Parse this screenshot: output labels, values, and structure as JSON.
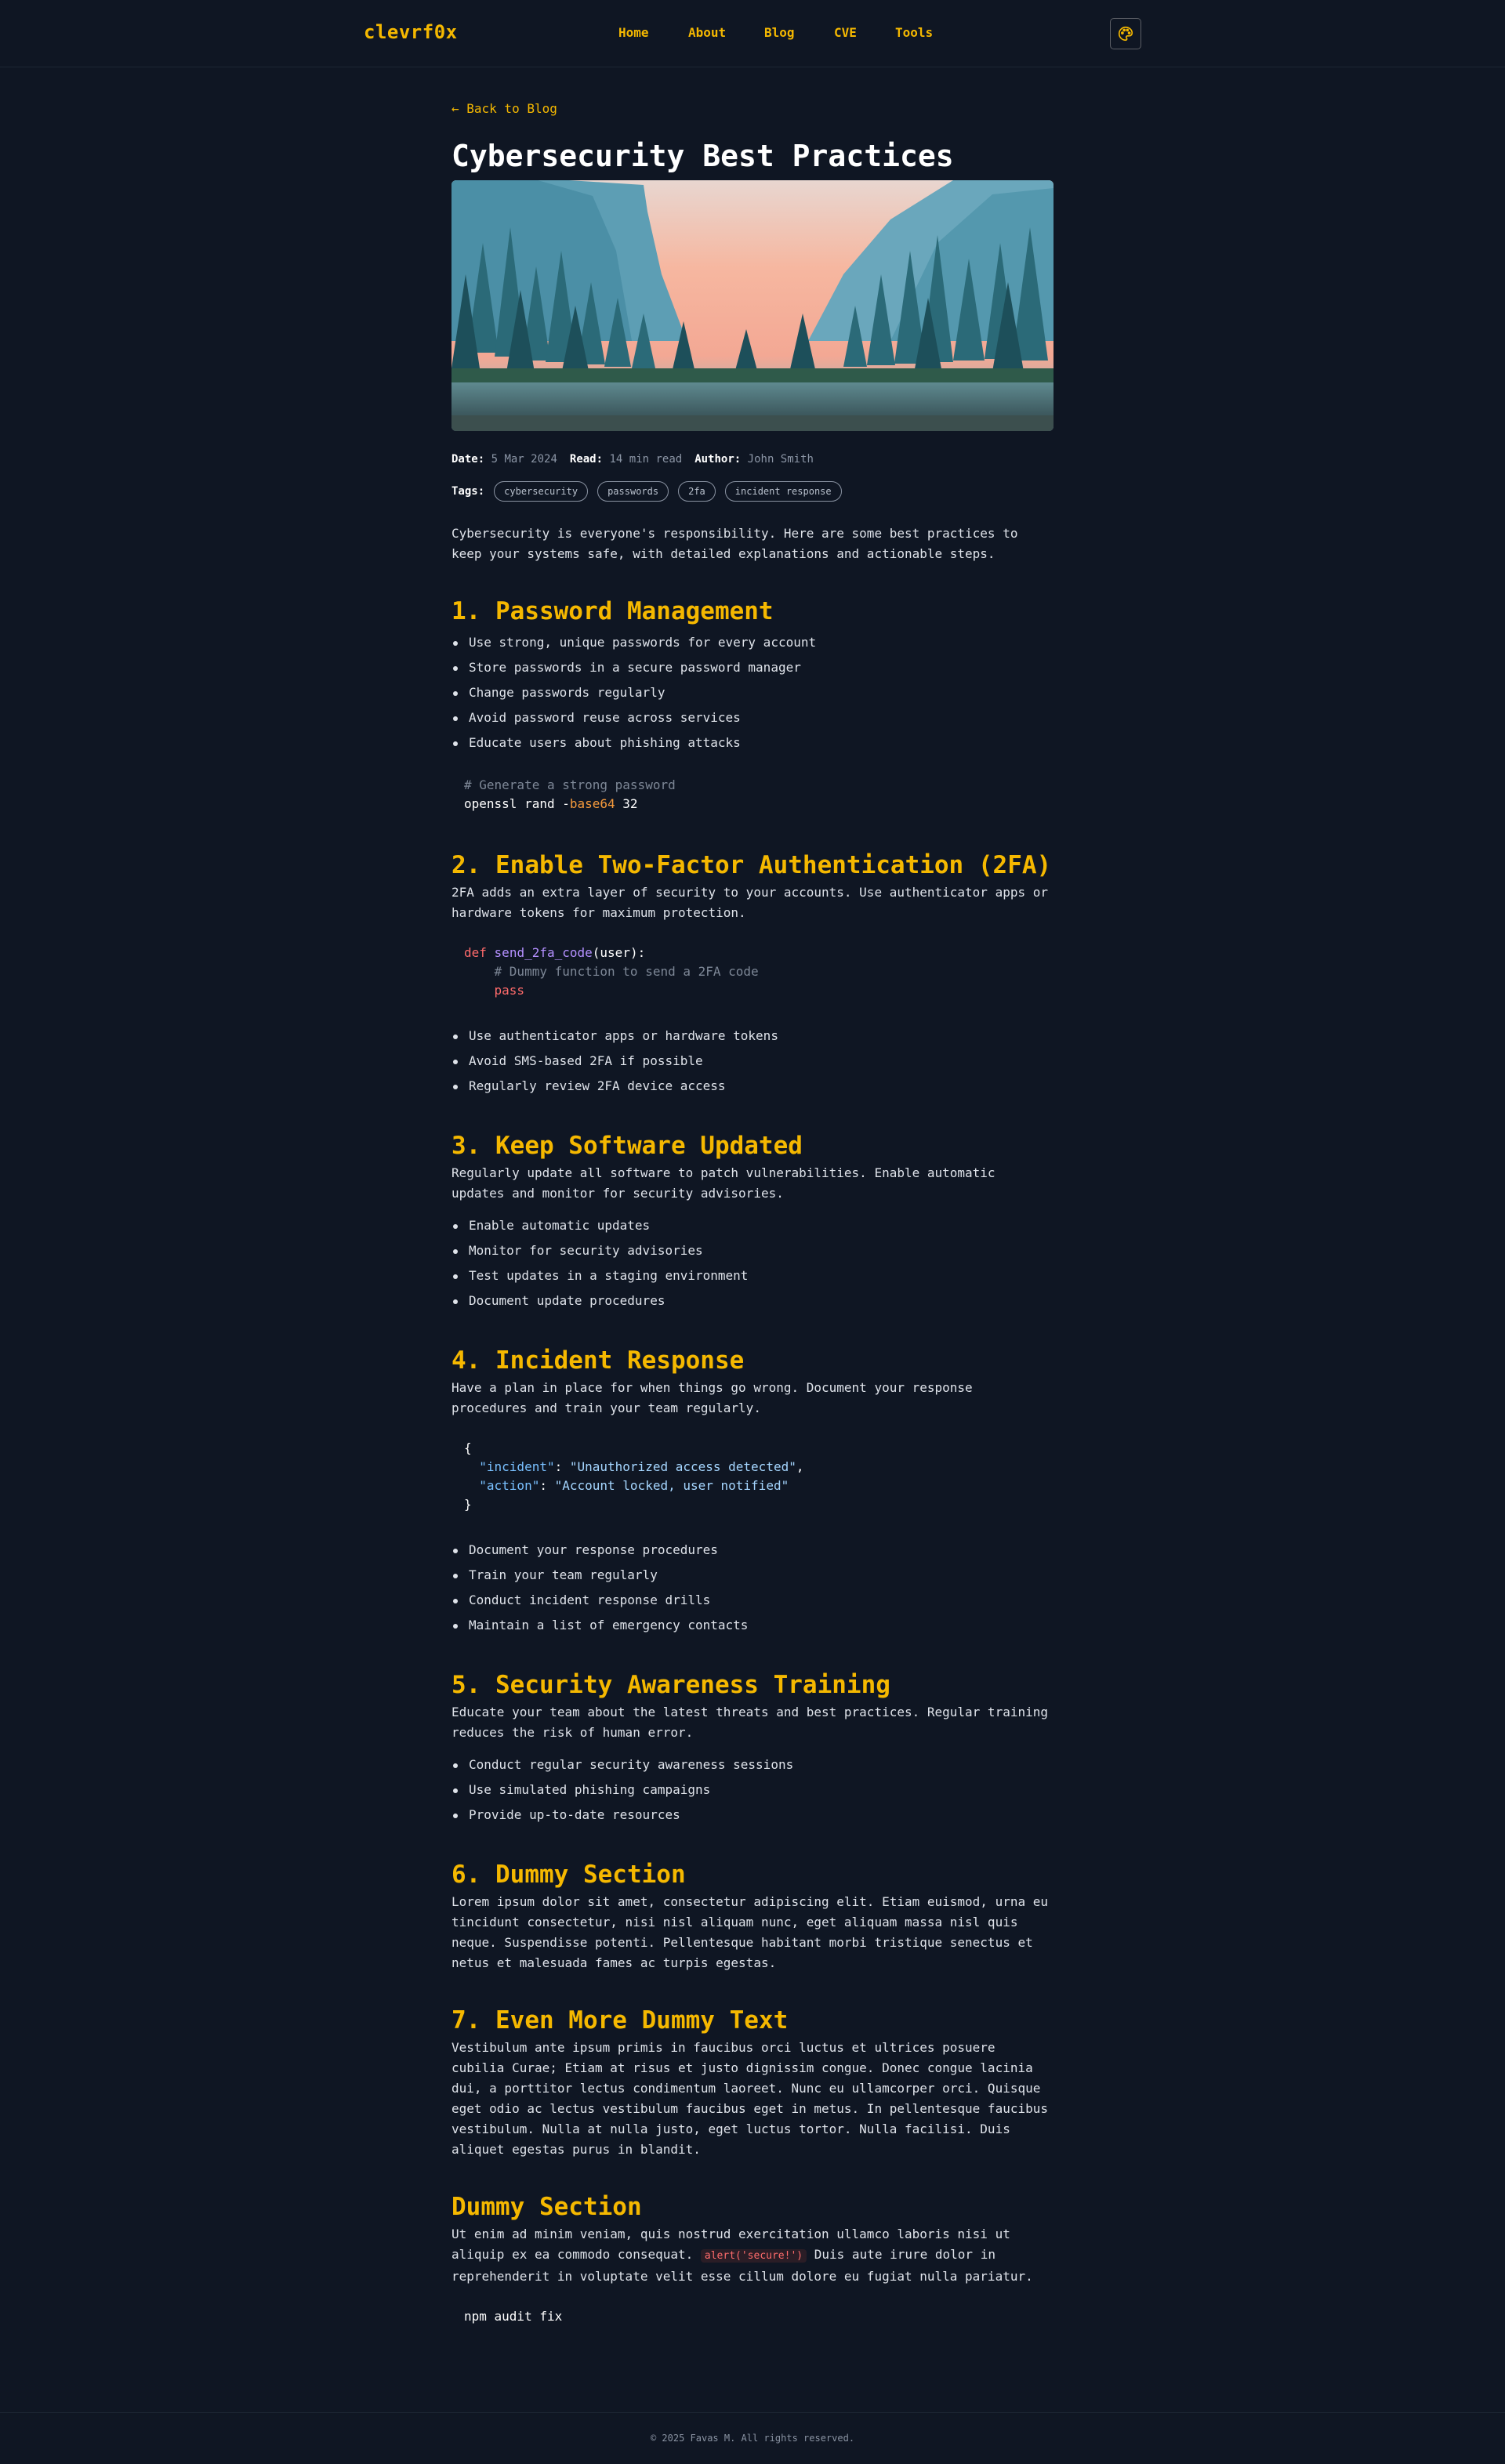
{
  "header": {
    "brand": "clevrf0x",
    "nav": [
      {
        "label": "Home"
      },
      {
        "label": "About"
      },
      {
        "label": "Blog"
      },
      {
        "label": "CVE"
      },
      {
        "label": "Tools"
      }
    ],
    "theme_icon": "palette-icon"
  },
  "article": {
    "back_label": "← Back to Blog",
    "title": "Cybersecurity Best Practices",
    "hero_image": "mountain-forest-landscape",
    "meta": {
      "date_label": "Date:",
      "date": "5 Mar 2024",
      "read_label": "Read:",
      "read": "14 min read",
      "author_label": "Author:",
      "author": "John Smith"
    },
    "tags_label": "Tags:",
    "tags": [
      "cybersecurity",
      "passwords",
      "2fa",
      "incident response"
    ],
    "intro": "Cybersecurity is everyone's responsibility. Here are some best practices to keep your systems safe, with detailed explanations and actionable steps.",
    "sections": [
      {
        "heading": "1. Password Management",
        "bullets": [
          "Use strong, unique passwords for every account",
          "Store passwords in a secure password manager",
          "Change passwords regularly",
          "Avoid password reuse across services",
          "Educate users about phishing attacks"
        ],
        "code": {
          "comment": "# Generate a strong password",
          "cmd": "openssl rand -",
          "flag": "base64",
          "arg": " 32"
        }
      },
      {
        "heading": "2. Enable Two-Factor Authentication (2FA)",
        "text": "2FA adds an extra layer of security to your accounts. Use authenticator apps or hardware tokens for maximum protection.",
        "code": {
          "kw": "def",
          "fn": "send_2fa_code",
          "args": "(user):",
          "comment": "# Dummy function to send a 2FA code",
          "pass": "pass"
        },
        "bullets": [
          "Use authenticator apps or hardware tokens",
          "Avoid SMS-based 2FA if possible",
          "Regularly review 2FA device access"
        ]
      },
      {
        "heading": "3. Keep Software Updated",
        "text": "Regularly update all software to patch vulnerabilities. Enable automatic updates and monitor for security advisories.",
        "bullets": [
          "Enable automatic updates",
          "Monitor for security advisories",
          "Test updates in a staging environment",
          "Document update procedures"
        ]
      },
      {
        "heading": "4. Incident Response",
        "text": "Have a plan in place for when things go wrong. Document your response procedures and train your team regularly.",
        "code": {
          "open": "{",
          "k1": "\"incident\"",
          "v1": "\"Unauthorized access detected\"",
          "k2": "\"action\"",
          "v2": "\"Account locked, user notified\"",
          "close": "}"
        },
        "bullets": [
          "Document your response procedures",
          "Train your team regularly",
          "Conduct incident response drills",
          "Maintain a list of emergency contacts"
        ]
      },
      {
        "heading": "5. Security Awareness Training",
        "text": "Educate your team about the latest threats and best practices. Regular training reduces the risk of human error.",
        "bullets": [
          "Conduct regular security awareness sessions",
          "Use simulated phishing campaigns",
          "Provide up-to-date resources"
        ]
      },
      {
        "heading": "6. Dummy Section",
        "text": "Lorem ipsum dolor sit amet, consectetur adipiscing elit. Etiam euismod, urna eu tincidunt consectetur, nisi nisl aliquam nunc, eget aliquam massa nisl quis neque. Suspendisse potenti. Pellentesque habitant morbi tristique senectus et netus et malesuada fames ac turpis egestas."
      },
      {
        "heading": "7. Even More Dummy Text",
        "text": "Vestibulum ante ipsum primis in faucibus orci luctus et ultrices posuere cubilia Curae; Etiam at risus et justo dignissim congue. Donec congue lacinia dui, a porttitor lectus condimentum laoreet. Nunc eu ullamcorper orci. Quisque eget odio ac lectus vestibulum faucibus eget in metus. In pellentesque faucibus vestibulum. Nulla at nulla justo, eget luctus tortor. Nulla facilisi. Duis aliquet egestas purus in blandit."
      },
      {
        "heading": "Dummy Section",
        "text_before": "Ut enim ad minim veniam, quis nostrud exercitation ullamco laboris nisi ut aliquip ex ea commodo consequat.",
        "inline_code": "alert('secure!')",
        "text_after": "Duis aute irure dolor in reprehenderit in voluptate velit esse cillum dolore eu fugiat nulla pariatur.",
        "code": "npm audit fix"
      }
    ]
  },
  "footer": {
    "text": "© 2025 Favas M. All rights reserved."
  },
  "colors": {
    "accent": "#f5b800",
    "background": "#0f1623",
    "text": "#dfe3ea",
    "muted": "#8c96a6"
  }
}
